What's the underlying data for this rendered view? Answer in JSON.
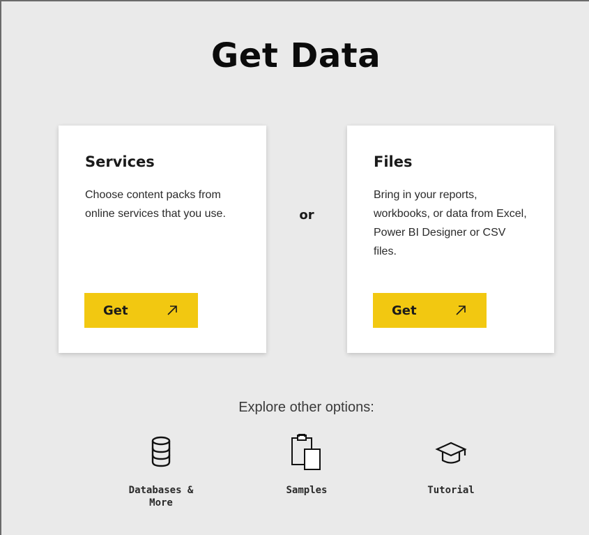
{
  "page": {
    "title": "Get Data",
    "or_label": "or"
  },
  "cards": {
    "services": {
      "heading": "Services",
      "description": "Choose content packs from online services that you use.",
      "button_label": "Get",
      "button_icon": "arrow-up-right-icon"
    },
    "files": {
      "heading": "Files",
      "description": "Bring in your reports, workbooks, or data from Excel, Power BI Designer or CSV files.",
      "button_label": "Get",
      "button_icon": "arrow-up-right-icon"
    }
  },
  "explore": {
    "label": "Explore other options:",
    "options": [
      {
        "label": "Databases & More",
        "icon": "database-icon"
      },
      {
        "label": "Samples",
        "icon": "clipboard-icon"
      },
      {
        "label": "Tutorial",
        "icon": "graduation-cap-icon"
      }
    ]
  },
  "colors": {
    "background": "#eaeaea",
    "card": "#ffffff",
    "accent": "#f2c811"
  }
}
